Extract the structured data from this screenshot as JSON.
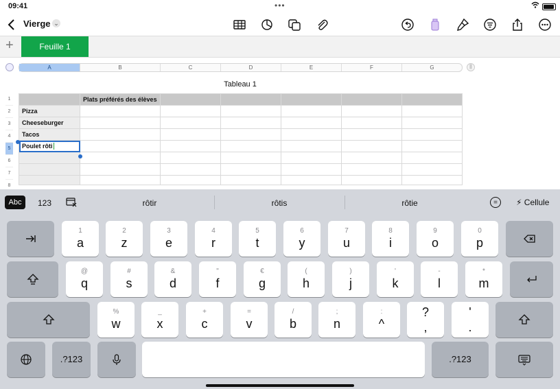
{
  "status": {
    "time": "09:41",
    "dots": "•••",
    "wifi": "wifi"
  },
  "toolbar": {
    "title": "Vierge",
    "title_chevron": "⌄"
  },
  "sheets": {
    "add": "+",
    "active_tab": "Feuille 1"
  },
  "columns": [
    "A",
    "B",
    "C",
    "D",
    "E",
    "F",
    "G"
  ],
  "rows": [
    "1",
    "2",
    "3",
    "4",
    "5",
    "6",
    "7",
    "8"
  ],
  "table": {
    "title": "Tableau 1",
    "header": "Plats préférés des élèves",
    "items": [
      "Pizza",
      "Cheeseburger",
      "Tacos",
      "Poulet rôti"
    ]
  },
  "predictions": {
    "mode_abc": "Abc",
    "mode_123": "123",
    "words": [
      "rôtir",
      "rôtis",
      "rôtie"
    ],
    "equals": "=",
    "cell": "Cellule",
    "cell_icon": "⚡"
  },
  "keyboard": {
    "row1": [
      {
        "sub": "1",
        "main": "a"
      },
      {
        "sub": "2",
        "main": "z"
      },
      {
        "sub": "3",
        "main": "e"
      },
      {
        "sub": "4",
        "main": "r"
      },
      {
        "sub": "5",
        "main": "t"
      },
      {
        "sub": "6",
        "main": "y"
      },
      {
        "sub": "7",
        "main": "u"
      },
      {
        "sub": "8",
        "main": "i"
      },
      {
        "sub": "9",
        "main": "o"
      },
      {
        "sub": "0",
        "main": "p"
      }
    ],
    "row2": [
      {
        "sub": "@",
        "main": "q"
      },
      {
        "sub": "#",
        "main": "s"
      },
      {
        "sub": "&",
        "main": "d"
      },
      {
        "sub": "\"",
        "main": "f"
      },
      {
        "sub": "€",
        "main": "g"
      },
      {
        "sub": "(",
        "main": "h"
      },
      {
        "sub": ")",
        "main": "j"
      },
      {
        "sub": "'",
        "main": "k"
      },
      {
        "sub": "-",
        "main": "l"
      },
      {
        "sub": "*",
        "main": "m"
      }
    ],
    "row3": [
      {
        "sub": "%",
        "main": "w"
      },
      {
        "sub": "_",
        "main": "x"
      },
      {
        "sub": "+",
        "main": "c"
      },
      {
        "sub": "=",
        "main": "v"
      },
      {
        "sub": "/",
        "main": "b"
      },
      {
        "sub": ";",
        "main": "n"
      },
      {
        "sub": ":",
        "main": "^"
      },
      {
        "sub": "?",
        "main": ","
      },
      {
        "sub": "'",
        "main": "."
      }
    ],
    "numbers_label": ".?123",
    "colors": {
      "key_bg": "#ffffff",
      "dark_key_bg": "#adb2ba",
      "keyboard_bg": "#d3d6dc",
      "sheet_tab": "#12a54a",
      "selection": "#2a6ec9"
    }
  }
}
